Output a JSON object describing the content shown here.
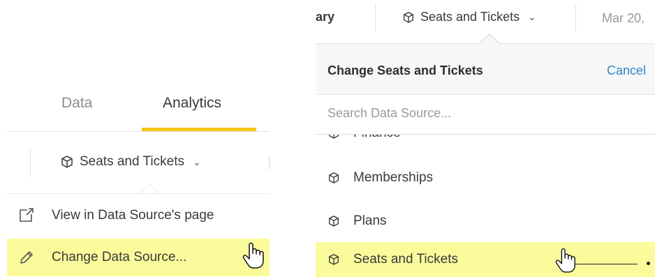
{
  "left_panel": {
    "tabs": [
      {
        "label": "Data",
        "active": false
      },
      {
        "label": "Analytics",
        "active": true
      }
    ],
    "datasource_button": {
      "label": "Seats and Tickets",
      "icon": "cube-icon",
      "chevron": "⌄"
    },
    "menu": [
      {
        "label": "View in Data Source's page",
        "icon": "external-link-icon",
        "highlighted": false
      },
      {
        "label": "Change Data Source...",
        "icon": "pencil-icon",
        "highlighted": true
      }
    ]
  },
  "right_panel": {
    "topbar": {
      "partial_left": "ary",
      "datasource_label": "Seats and Tickets",
      "chevron": "⌄",
      "date_partial": "Mar 20,"
    },
    "dropdown": {
      "title": "Change Seats and Tickets",
      "cancel_label": "Cancel",
      "search_placeholder": "Search Data Source...",
      "items": [
        {
          "label": "Finance",
          "icon": "cube-icon",
          "highlighted": false
        },
        {
          "label": "Memberships",
          "icon": "cube-icon",
          "highlighted": false
        },
        {
          "label": "Plans",
          "icon": "cube-icon",
          "highlighted": false
        },
        {
          "label": "Seats and Tickets",
          "icon": "cube-icon",
          "highlighted": true
        }
      ]
    }
  },
  "colors": {
    "accent_underline": "#f5c518",
    "highlight": "#fbfb9c",
    "link": "#2f86c6"
  }
}
